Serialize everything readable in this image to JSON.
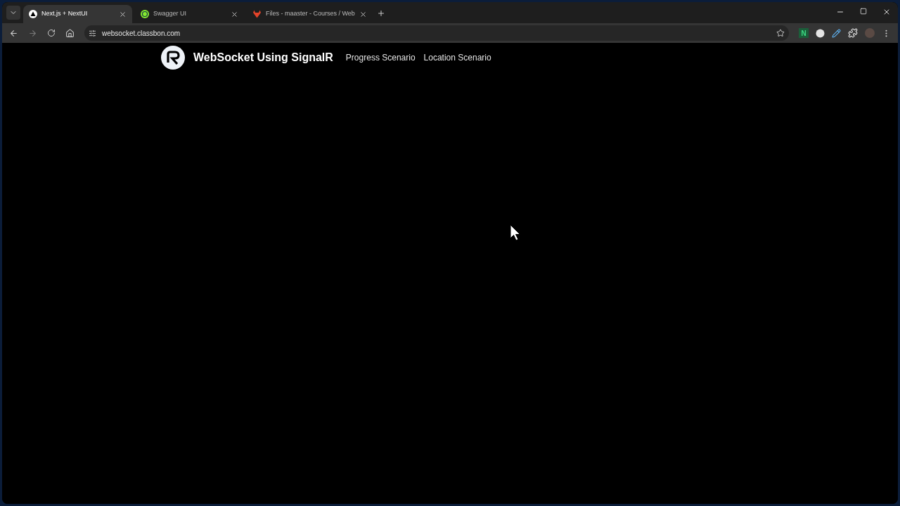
{
  "tabs": [
    {
      "title": "Next.js + NextUI",
      "selected": true,
      "kind": "triangle"
    },
    {
      "title": "Swagger UI",
      "selected": false,
      "kind": "swagger"
    },
    {
      "title": "Files - maaster - Courses / Web",
      "selected": false,
      "kind": "fox"
    }
  ],
  "address_bar": {
    "url": "websocket.classbon.com"
  },
  "extensions": [
    {
      "kind": "letter",
      "label": "N"
    },
    {
      "kind": "circle"
    },
    {
      "kind": "pen"
    },
    {
      "kind": "puzzle"
    }
  ],
  "page": {
    "title": "WebSocket Using SignalR",
    "nav": [
      "Progress Scenario",
      "Location Scenario"
    ]
  }
}
